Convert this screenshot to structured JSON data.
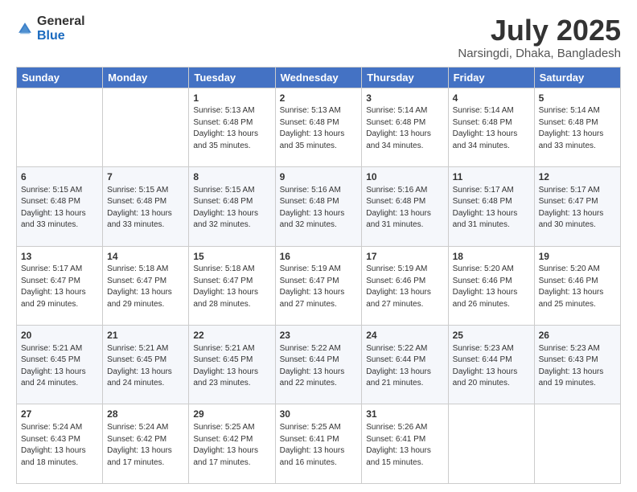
{
  "header": {
    "logo_general": "General",
    "logo_blue": "Blue",
    "main_title": "July 2025",
    "subtitle": "Narsingdi, Dhaka, Bangladesh"
  },
  "columns": [
    "Sunday",
    "Monday",
    "Tuesday",
    "Wednesday",
    "Thursday",
    "Friday",
    "Saturday"
  ],
  "weeks": [
    [
      {
        "day": "",
        "info": ""
      },
      {
        "day": "",
        "info": ""
      },
      {
        "day": "1",
        "info": "Sunrise: 5:13 AM\nSunset: 6:48 PM\nDaylight: 13 hours and 35 minutes."
      },
      {
        "day": "2",
        "info": "Sunrise: 5:13 AM\nSunset: 6:48 PM\nDaylight: 13 hours and 35 minutes."
      },
      {
        "day": "3",
        "info": "Sunrise: 5:14 AM\nSunset: 6:48 PM\nDaylight: 13 hours and 34 minutes."
      },
      {
        "day": "4",
        "info": "Sunrise: 5:14 AM\nSunset: 6:48 PM\nDaylight: 13 hours and 34 minutes."
      },
      {
        "day": "5",
        "info": "Sunrise: 5:14 AM\nSunset: 6:48 PM\nDaylight: 13 hours and 33 minutes."
      }
    ],
    [
      {
        "day": "6",
        "info": "Sunrise: 5:15 AM\nSunset: 6:48 PM\nDaylight: 13 hours and 33 minutes."
      },
      {
        "day": "7",
        "info": "Sunrise: 5:15 AM\nSunset: 6:48 PM\nDaylight: 13 hours and 33 minutes."
      },
      {
        "day": "8",
        "info": "Sunrise: 5:15 AM\nSunset: 6:48 PM\nDaylight: 13 hours and 32 minutes."
      },
      {
        "day": "9",
        "info": "Sunrise: 5:16 AM\nSunset: 6:48 PM\nDaylight: 13 hours and 32 minutes."
      },
      {
        "day": "10",
        "info": "Sunrise: 5:16 AM\nSunset: 6:48 PM\nDaylight: 13 hours and 31 minutes."
      },
      {
        "day": "11",
        "info": "Sunrise: 5:17 AM\nSunset: 6:48 PM\nDaylight: 13 hours and 31 minutes."
      },
      {
        "day": "12",
        "info": "Sunrise: 5:17 AM\nSunset: 6:47 PM\nDaylight: 13 hours and 30 minutes."
      }
    ],
    [
      {
        "day": "13",
        "info": "Sunrise: 5:17 AM\nSunset: 6:47 PM\nDaylight: 13 hours and 29 minutes."
      },
      {
        "day": "14",
        "info": "Sunrise: 5:18 AM\nSunset: 6:47 PM\nDaylight: 13 hours and 29 minutes."
      },
      {
        "day": "15",
        "info": "Sunrise: 5:18 AM\nSunset: 6:47 PM\nDaylight: 13 hours and 28 minutes."
      },
      {
        "day": "16",
        "info": "Sunrise: 5:19 AM\nSunset: 6:47 PM\nDaylight: 13 hours and 27 minutes."
      },
      {
        "day": "17",
        "info": "Sunrise: 5:19 AM\nSunset: 6:46 PM\nDaylight: 13 hours and 27 minutes."
      },
      {
        "day": "18",
        "info": "Sunrise: 5:20 AM\nSunset: 6:46 PM\nDaylight: 13 hours and 26 minutes."
      },
      {
        "day": "19",
        "info": "Sunrise: 5:20 AM\nSunset: 6:46 PM\nDaylight: 13 hours and 25 minutes."
      }
    ],
    [
      {
        "day": "20",
        "info": "Sunrise: 5:21 AM\nSunset: 6:45 PM\nDaylight: 13 hours and 24 minutes."
      },
      {
        "day": "21",
        "info": "Sunrise: 5:21 AM\nSunset: 6:45 PM\nDaylight: 13 hours and 24 minutes."
      },
      {
        "day": "22",
        "info": "Sunrise: 5:21 AM\nSunset: 6:45 PM\nDaylight: 13 hours and 23 minutes."
      },
      {
        "day": "23",
        "info": "Sunrise: 5:22 AM\nSunset: 6:44 PM\nDaylight: 13 hours and 22 minutes."
      },
      {
        "day": "24",
        "info": "Sunrise: 5:22 AM\nSunset: 6:44 PM\nDaylight: 13 hours and 21 minutes."
      },
      {
        "day": "25",
        "info": "Sunrise: 5:23 AM\nSunset: 6:44 PM\nDaylight: 13 hours and 20 minutes."
      },
      {
        "day": "26",
        "info": "Sunrise: 5:23 AM\nSunset: 6:43 PM\nDaylight: 13 hours and 19 minutes."
      }
    ],
    [
      {
        "day": "27",
        "info": "Sunrise: 5:24 AM\nSunset: 6:43 PM\nDaylight: 13 hours and 18 minutes."
      },
      {
        "day": "28",
        "info": "Sunrise: 5:24 AM\nSunset: 6:42 PM\nDaylight: 13 hours and 17 minutes."
      },
      {
        "day": "29",
        "info": "Sunrise: 5:25 AM\nSunset: 6:42 PM\nDaylight: 13 hours and 17 minutes."
      },
      {
        "day": "30",
        "info": "Sunrise: 5:25 AM\nSunset: 6:41 PM\nDaylight: 13 hours and 16 minutes."
      },
      {
        "day": "31",
        "info": "Sunrise: 5:26 AM\nSunset: 6:41 PM\nDaylight: 13 hours and 15 minutes."
      },
      {
        "day": "",
        "info": ""
      },
      {
        "day": "",
        "info": ""
      }
    ]
  ]
}
